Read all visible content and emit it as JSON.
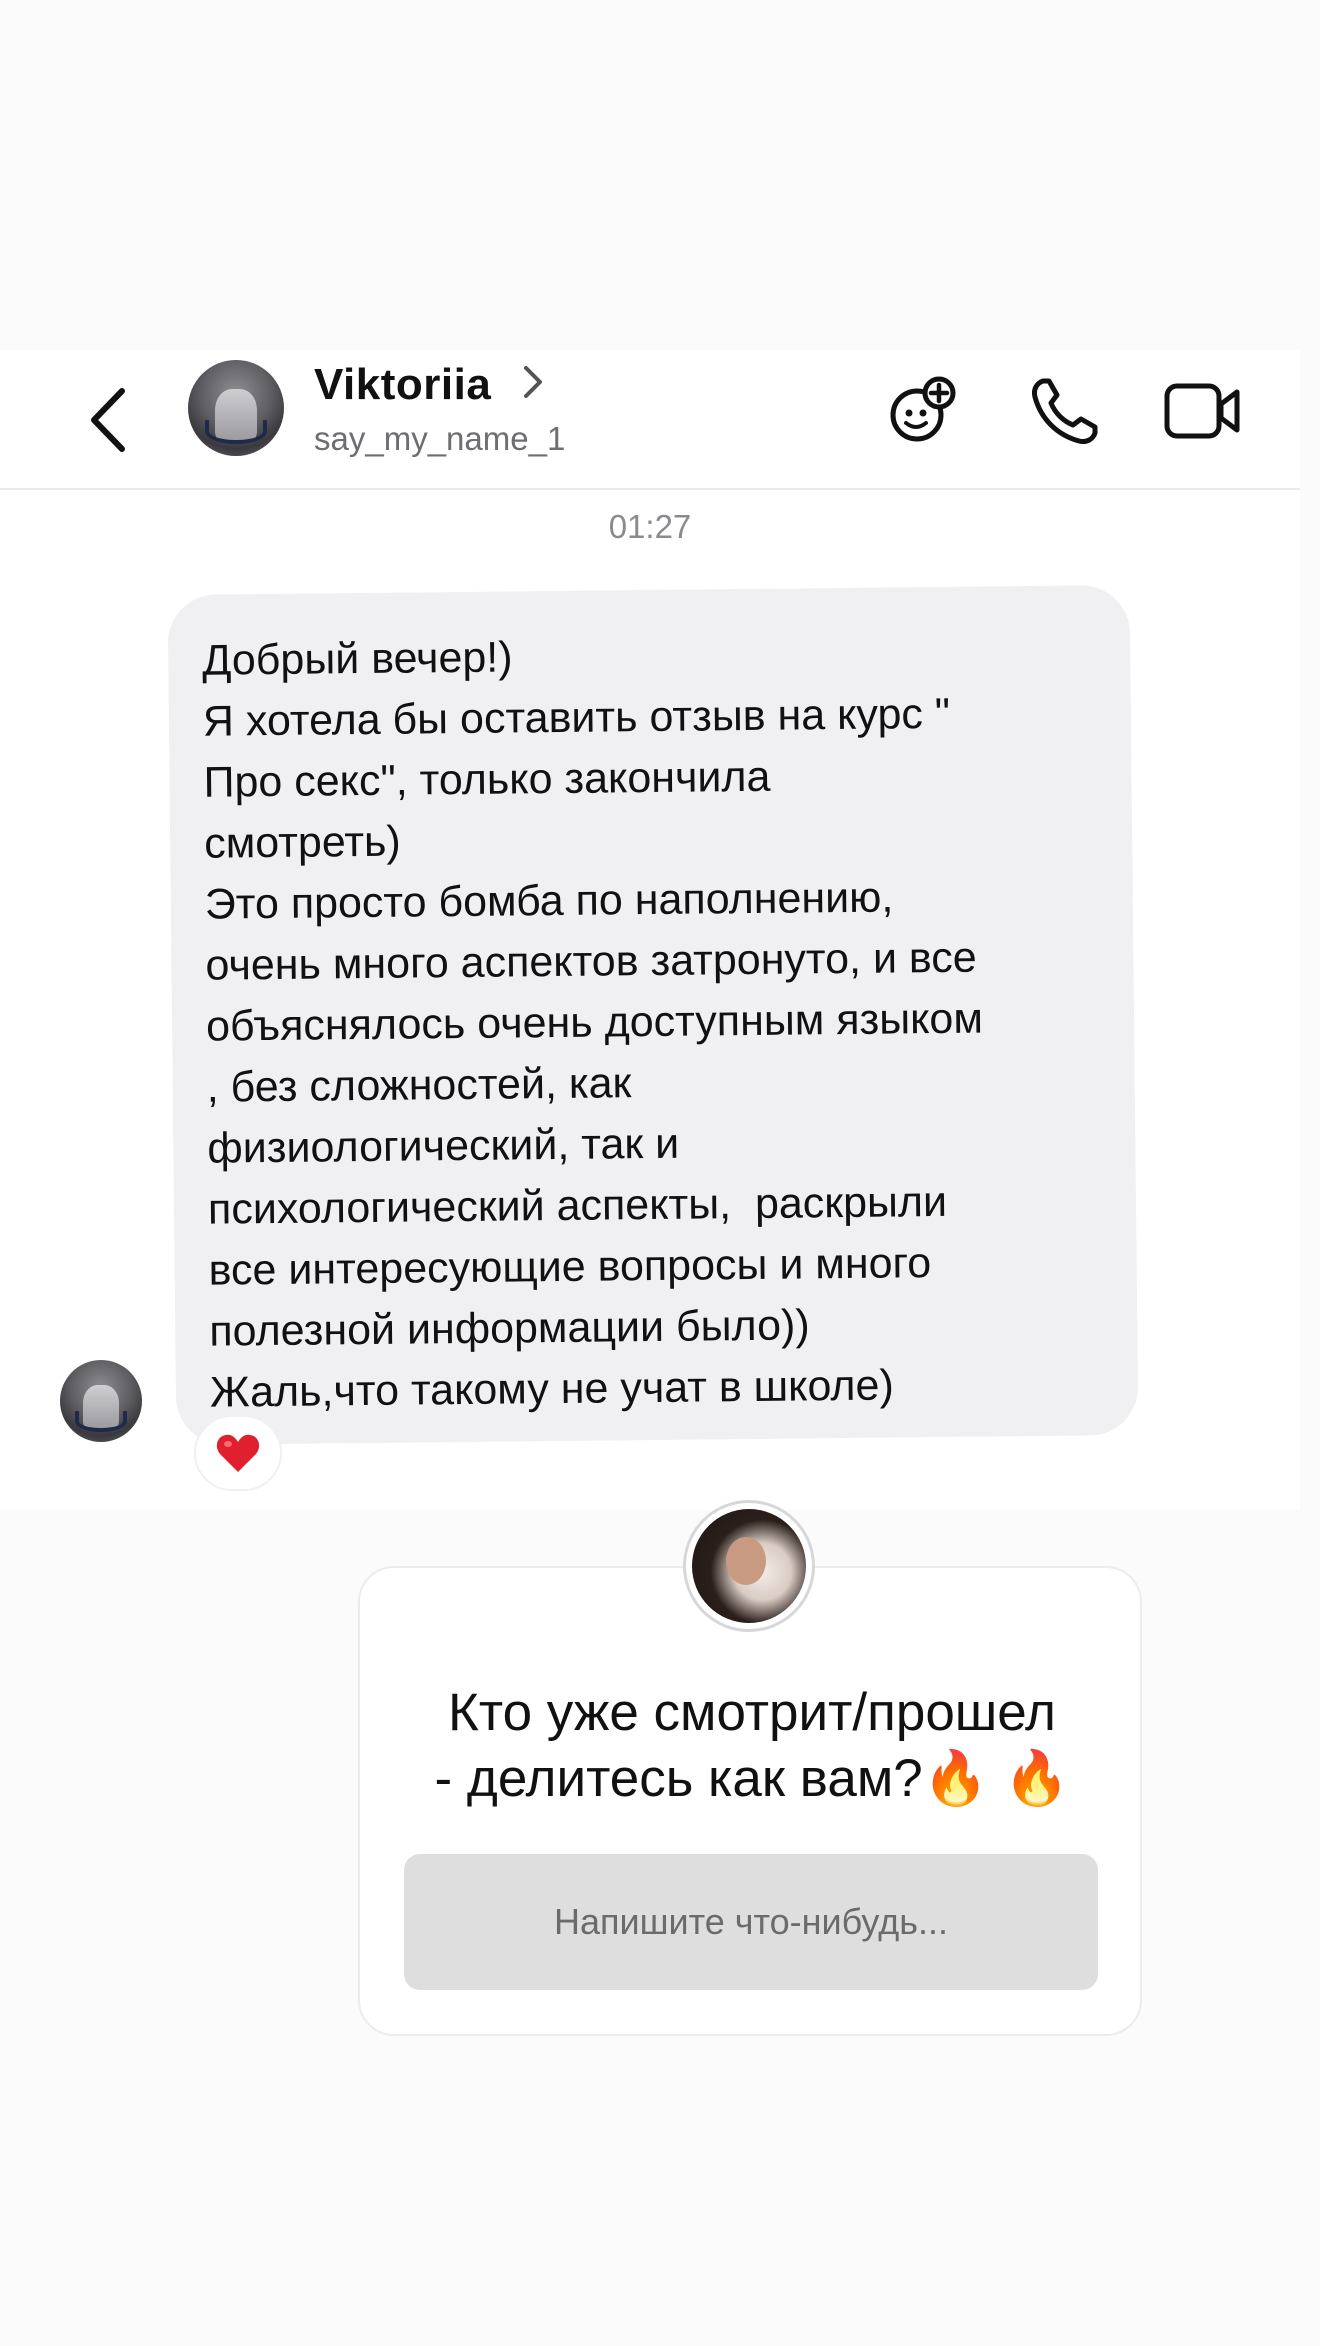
{
  "header": {
    "name": "Viktoriia",
    "username": "say_my_name_1",
    "icons": [
      "back-chevron-icon",
      "chevron-right-icon",
      "effects-icon",
      "phone-icon",
      "video-camera-icon"
    ]
  },
  "conversation": {
    "timestamp": "01:27",
    "message": "Добрый вечер!)\nЯ хотела бы оставить отзыв на курс \"\nПро секс\", только закончила\nсмотреть)\nЭто просто бомба по наполнению,\nочень много аспектов затронуто, и все\nобъяснялось очень доступным языком\n, без сложностей, как\nфизиологический, так и\nпсихологический аспекты,  раскрыли\nвсе интересующие вопросы и много\nполезной информации было))\nЖаль,что такому не учат в школе)",
    "reaction": "❤️"
  },
  "sticker": {
    "question_line1": "Кто уже смотрит/прошел",
    "question_line2": "- делитесь как вам?🔥 🔥",
    "placeholder": "Напишите что-нибудь..."
  },
  "colors": {
    "bubble": "#f0f0f3",
    "input": "#dedede",
    "secondary_text": "#6d6d72"
  }
}
